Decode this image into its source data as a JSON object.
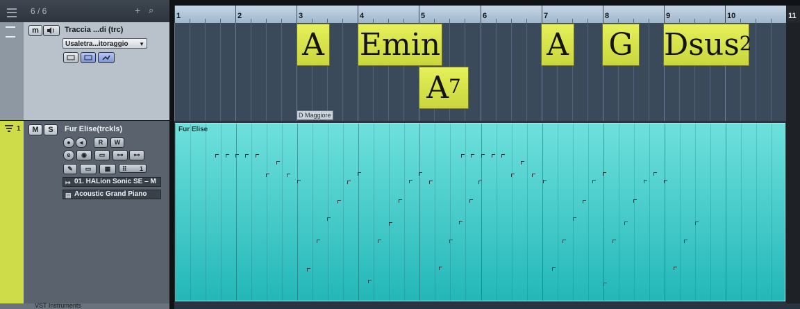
{
  "toolbar": {
    "track_count": "6 / 6",
    "add_icon": "+",
    "search_icon": "⌕"
  },
  "chord_track": {
    "name": "Traccia ...di (trc)",
    "mute_label": "m",
    "voicing_dropdown": "Usaletra...itoraggio"
  },
  "instrument_track": {
    "number": "1",
    "name": "Fur Elise(trckls)",
    "mute_label": "M",
    "solo_label": "S",
    "read_label": "R",
    "write_label": "W",
    "midi_channel": "1",
    "output": "01. HALion Sonic SE – M",
    "program": "Acoustic Grand Piano"
  },
  "next_track": {
    "name": "VST Instruments"
  },
  "ruler": {
    "bars": [
      "1",
      "2",
      "3",
      "4",
      "5",
      "6",
      "7",
      "8",
      "9",
      "10",
      "11"
    ]
  },
  "chords": [
    {
      "root": "A",
      "suffix": "",
      "sup": ""
    },
    {
      "root": "E",
      "suffix": "min",
      "sup": ""
    },
    {
      "root": "A",
      "suffix": "",
      "sup": "7"
    },
    {
      "root": "A",
      "suffix": "",
      "sup": ""
    },
    {
      "root": "G",
      "suffix": "",
      "sup": ""
    },
    {
      "root": "D",
      "suffix": "sus",
      "sup": "2"
    }
  ],
  "scale_event": "D Maggiore",
  "part": {
    "name": "Fur Elise"
  },
  "colors": {
    "chord_event": "#d7e24a",
    "midi_part": "#3cc8c6",
    "track_strip": "#cfdc4a"
  }
}
